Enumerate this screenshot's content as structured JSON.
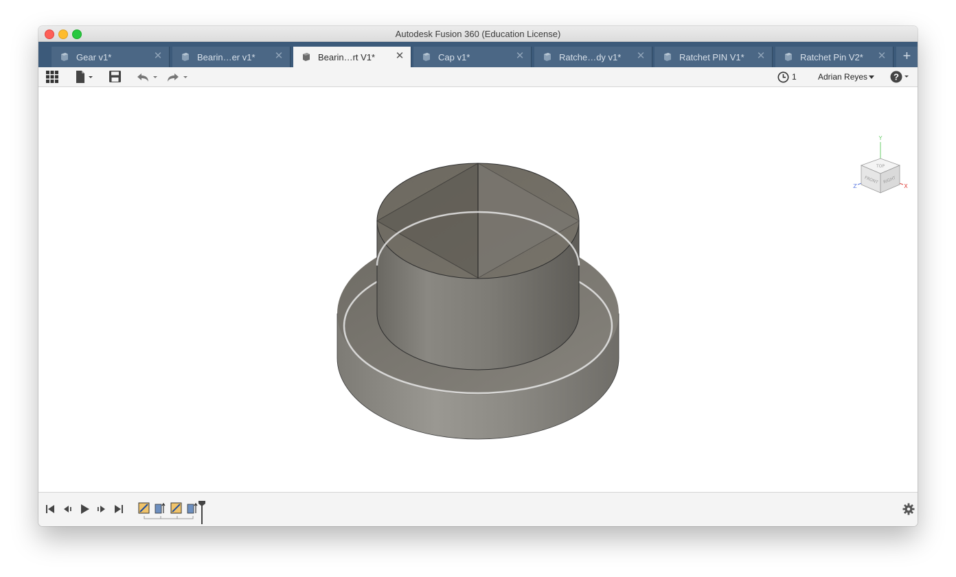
{
  "window": {
    "title": "Autodesk Fusion 360 (Education License)"
  },
  "tabs": [
    {
      "label": "Gear v1*",
      "active": false
    },
    {
      "label": "Bearin…er v1*",
      "active": false
    },
    {
      "label": "Bearin…rt V1*",
      "active": true
    },
    {
      "label": "Cap v1*",
      "active": false
    },
    {
      "label": "Ratche…dy v1*",
      "active": false
    },
    {
      "label": "Ratchet PIN V1*",
      "active": false
    },
    {
      "label": "Ratchet Pin V2*",
      "active": false
    }
  ],
  "toolbar": {
    "job_count": "1",
    "user_name": "Adrian Reyes",
    "icons": [
      "app-grid-icon",
      "file-icon",
      "save-icon",
      "undo-icon",
      "redo-icon",
      "clock-icon",
      "help-icon"
    ]
  },
  "viewcube": {
    "faces": [
      "TOP",
      "FRONT",
      "RIGHT"
    ],
    "axes": [
      "Y",
      "Z",
      "X"
    ],
    "colors": {
      "x": "#e0443e",
      "y": "#6ccf6c",
      "z": "#5a78e0"
    }
  },
  "timeline": {
    "icons": [
      "go-to-start-icon",
      "step-back-icon",
      "play-icon",
      "step-forward-icon",
      "go-to-end-icon",
      "sketch-feature-icon",
      "extrude-feature-icon",
      "sketch-feature-icon",
      "extrude-feature-icon",
      "timeline-marker-icon",
      "settings-gear-icon"
    ]
  },
  "colors": {
    "tabbar": "#3c5a7a",
    "active_tab": "#f4f4f4",
    "model": "#8a8780"
  }
}
